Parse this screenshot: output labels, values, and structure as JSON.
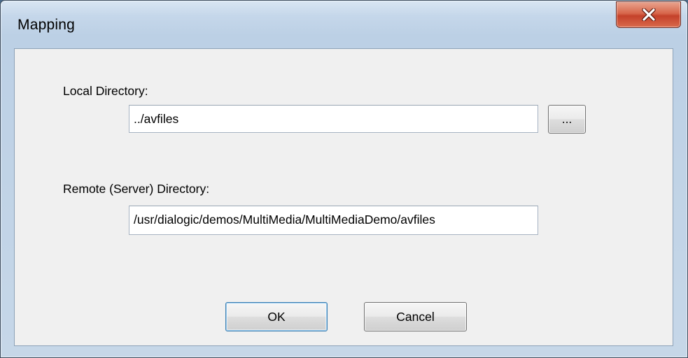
{
  "window": {
    "title": "Mapping",
    "close_icon": "close-icon"
  },
  "local": {
    "label": "Local Directory:",
    "value": "../avfiles",
    "browse_label": "..."
  },
  "remote": {
    "label": "Remote (Server) Directory:",
    "value": "/usr/dialogic/demos/MultiMedia/MultiMediaDemo/avfiles"
  },
  "buttons": {
    "ok_label": "OK",
    "cancel_label": "Cancel"
  },
  "colors": {
    "close_button": "#c94b33",
    "default_button_border": "#3c7fb1",
    "client_background": "#f0f0f0"
  }
}
